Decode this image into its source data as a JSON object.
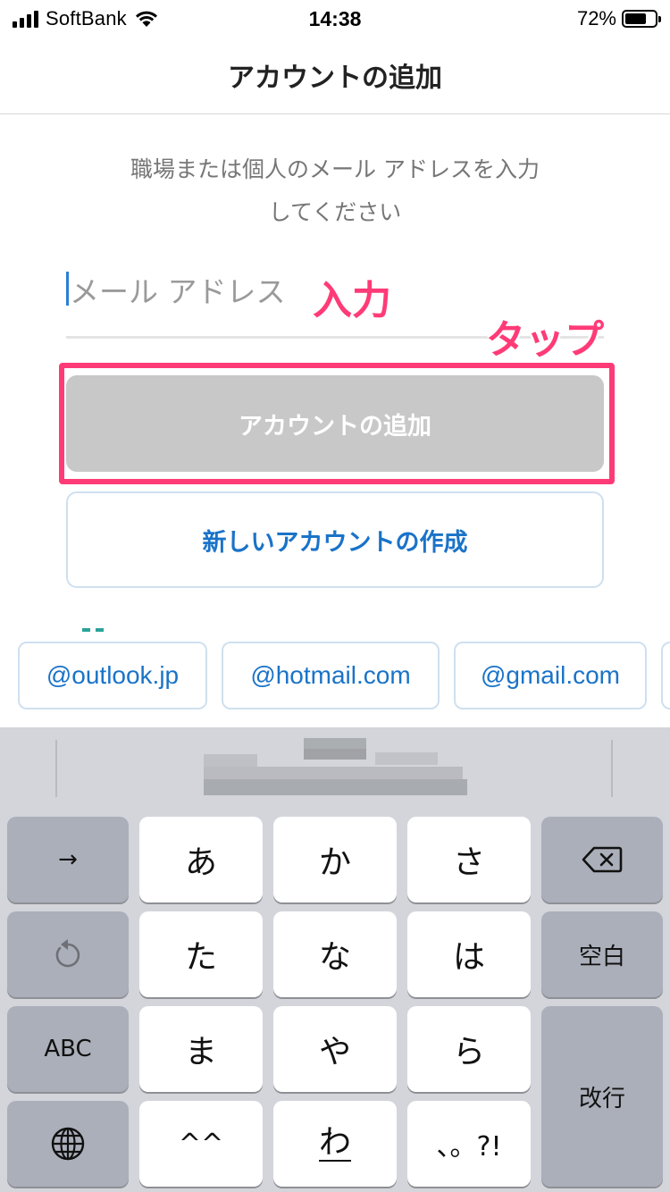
{
  "status_bar": {
    "carrier": "SoftBank",
    "time": "14:38",
    "battery_percent": "72%",
    "battery_level": 0.72
  },
  "header": {
    "title": "アカウントの追加"
  },
  "instructions": {
    "line1": "職場または個人のメール アドレスを入力",
    "line2": "してください"
  },
  "email": {
    "placeholder": "メール アドレス",
    "value": ""
  },
  "annotations": {
    "input_label": "入力",
    "tap_label": "タップ",
    "color": "#ff3b77"
  },
  "buttons": {
    "add_account": "アカウントの追加",
    "create_account": "新しいアカウントの作成"
  },
  "suggestions": [
    "@outlook.jp",
    "@hotmail.com",
    "@gmail.com"
  ],
  "keyboard": {
    "row1": {
      "left": "→",
      "keys": [
        "あ",
        "か",
        "さ"
      ],
      "right_icon": "backspace-icon"
    },
    "row2": {
      "left_icon": "undo-icon",
      "keys": [
        "た",
        "な",
        "は"
      ],
      "right": "空白"
    },
    "row3": {
      "left": "ABC",
      "keys": [
        "ま",
        "や",
        "ら"
      ]
    },
    "row4": {
      "left_icon": "globe-icon",
      "keys": [
        "^^",
        "わ",
        "、。?!"
      ]
    },
    "return": "改行"
  },
  "colors": {
    "accent": "#1a73c8",
    "disabled_button": "#c8c8c8",
    "keyboard_bg": "#d3d5db",
    "highlight": "#ff3b77"
  }
}
